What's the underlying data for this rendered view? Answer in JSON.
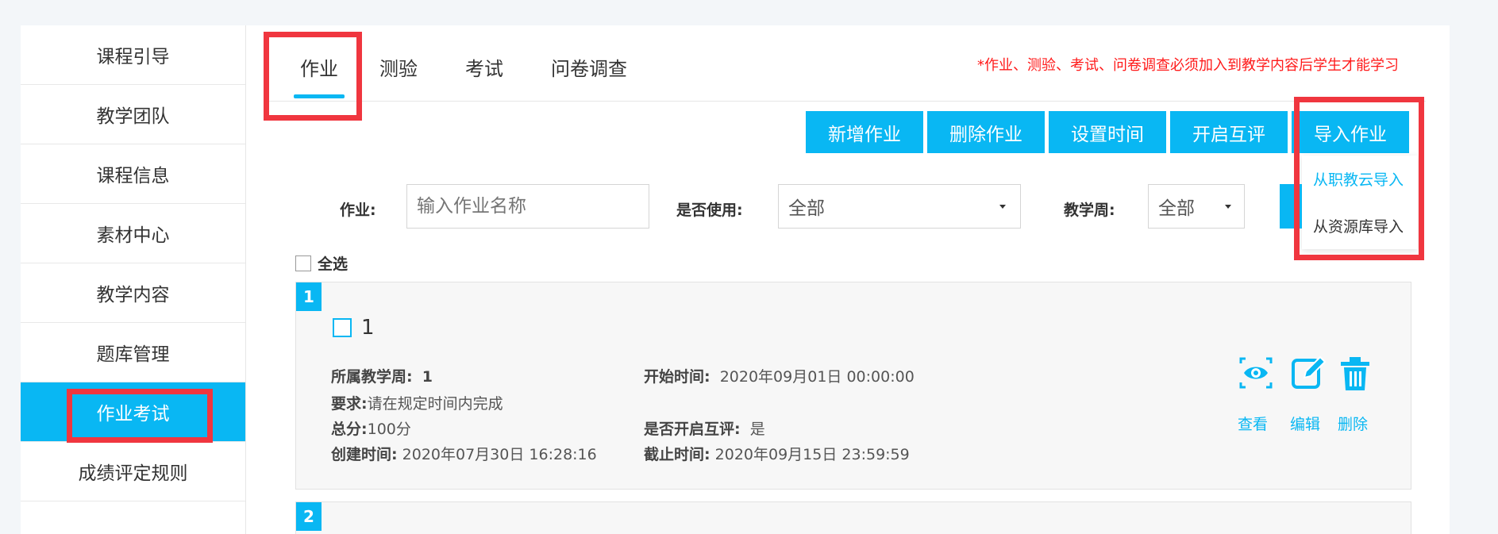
{
  "sidebar": {
    "items": [
      {
        "label": "课程引导"
      },
      {
        "label": "教学团队"
      },
      {
        "label": "课程信息"
      },
      {
        "label": "素材中心"
      },
      {
        "label": "教学内容"
      },
      {
        "label": "题库管理"
      },
      {
        "label": "作业考试",
        "active": true
      },
      {
        "label": "成绩评定规则"
      }
    ]
  },
  "tabs": [
    {
      "label": "作业",
      "active": true
    },
    {
      "label": "测验"
    },
    {
      "label": "考试"
    },
    {
      "label": "问卷调查"
    }
  ],
  "notice": "*作业、测验、考试、问卷调查必须加入到教学内容后学生才能学习",
  "toolbar": {
    "add": "新增作业",
    "delete": "删除作业",
    "set_time": "设置时间",
    "peer_review": "开启互评",
    "import": "导入作业"
  },
  "import_menu": {
    "from_zjy": "从职教云导入",
    "from_library": "从资源库导入"
  },
  "filters": {
    "homework_label": "作业:",
    "homework_placeholder": "输入作业名称",
    "used_label": "是否使用:",
    "used_value": "全部",
    "week_label": "教学周:",
    "week_value": "全部"
  },
  "select_all": "全选",
  "cards": [
    {
      "index": "1",
      "title": "1",
      "week_label": "所属教学周:",
      "week": "1",
      "start_label": "开始时间:",
      "start": "2020年09月01日 00:00:00",
      "req_label": "要求:",
      "req": "请在规定时间内完成",
      "score_label": "总分:",
      "score": "100分",
      "peer_label": "是否开启互评:",
      "peer": "是",
      "created_label": "创建时间:",
      "created": "2020年07月30日 16:28:16",
      "deadline_label": "截止时间:",
      "deadline": "2020年09月15日 23:59:59",
      "actions": {
        "view": "查看",
        "edit": "编辑",
        "delete": "删除"
      }
    },
    {
      "index": "2"
    }
  ],
  "colors": {
    "accent": "#09b7f3",
    "highlight_box": "#f0363f",
    "notice": "#ff1a1a"
  }
}
